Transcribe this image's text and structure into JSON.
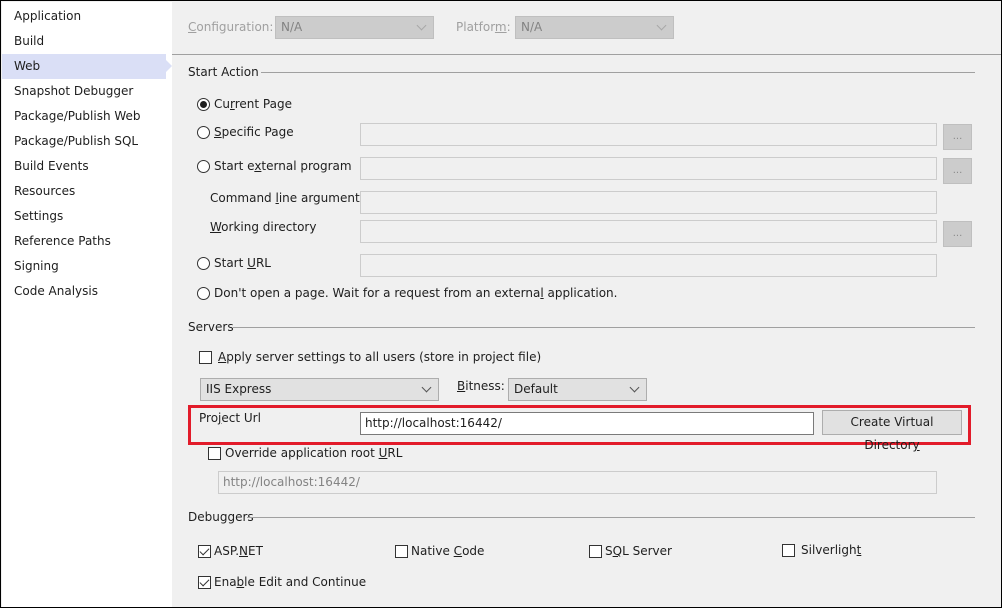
{
  "sidebar": {
    "items": [
      {
        "label": "Application"
      },
      {
        "label": "Build"
      },
      {
        "label": "Web",
        "active": true
      },
      {
        "label": "Snapshot Debugger"
      },
      {
        "label": "Package/Publish Web"
      },
      {
        "label": "Package/Publish SQL"
      },
      {
        "label": "Build Events"
      },
      {
        "label": "Resources"
      },
      {
        "label": "Settings"
      },
      {
        "label": "Reference Paths"
      },
      {
        "label": "Signing"
      },
      {
        "label": "Code Analysis"
      }
    ]
  },
  "header": {
    "configuration_label_accel": "C",
    "configuration_label_rest": "onfiguration:",
    "configuration_value": "N/A",
    "platform_label_pre": "Platfor",
    "platform_label_accel": "m",
    "platform_label_post": ":",
    "platform_value": "N/A"
  },
  "start_action": {
    "title": "Start Action",
    "current_page": {
      "pre": "Cu",
      "accel": "r",
      "post": "rent Page",
      "selected": true
    },
    "specific_page": {
      "pre": "",
      "accel": "S",
      "post": "pecific Page",
      "value": "",
      "browse": "..."
    },
    "external_program": {
      "pre": "Start e",
      "accel": "x",
      "post": "ternal program",
      "value": "",
      "browse": "..."
    },
    "command_line": {
      "pre": "Command ",
      "accel": "l",
      "post": "ine arguments",
      "value": ""
    },
    "working_dir": {
      "pre": "",
      "accel": "W",
      "post": "orking directory",
      "value": "",
      "browse": "..."
    },
    "start_url": {
      "pre": "Start ",
      "accel": "U",
      "post": "RL",
      "value": ""
    },
    "dont_open": {
      "pre": "Don't open a page.  Wait for a request from an externa",
      "accel": "l",
      "post": " application."
    }
  },
  "servers": {
    "title": "Servers",
    "apply_all": {
      "pre": "",
      "accel": "A",
      "post": "pply server settings to all users (store in project file)",
      "checked": false
    },
    "server_value": "IIS Express",
    "bitness_accel": "B",
    "bitness_rest": "itness:",
    "bitness_value": "Default",
    "project_url_pre": "Pro",
    "project_url_accel": "j",
    "project_url_post": "ect Url",
    "project_url_value": "http://localhost:16442/",
    "create_vdir_pre": "Create Virtual Director",
    "create_vdir_accel": "y",
    "override": {
      "pre": "Override application root ",
      "accel": "U",
      "post": "RL",
      "checked": false
    },
    "override_value": "http://localhost:16442/",
    "highlight_color": "#e21b2a"
  },
  "debuggers": {
    "title": "Debuggers",
    "aspnet": {
      "pre": "ASP.",
      "accel": "N",
      "post": "ET",
      "checked": true
    },
    "native": {
      "pre": "Native ",
      "accel": "C",
      "post": "ode",
      "checked": false
    },
    "sql": {
      "pre": "S",
      "accel": "Q",
      "post": "L Server",
      "checked": false
    },
    "silverlight": {
      "pre": "Silverligh",
      "accel": "t",
      "post": "",
      "checked": false
    },
    "edit_continue": {
      "pre": "Ena",
      "accel": "b",
      "post": "le Edit and Continue",
      "checked": true
    }
  }
}
